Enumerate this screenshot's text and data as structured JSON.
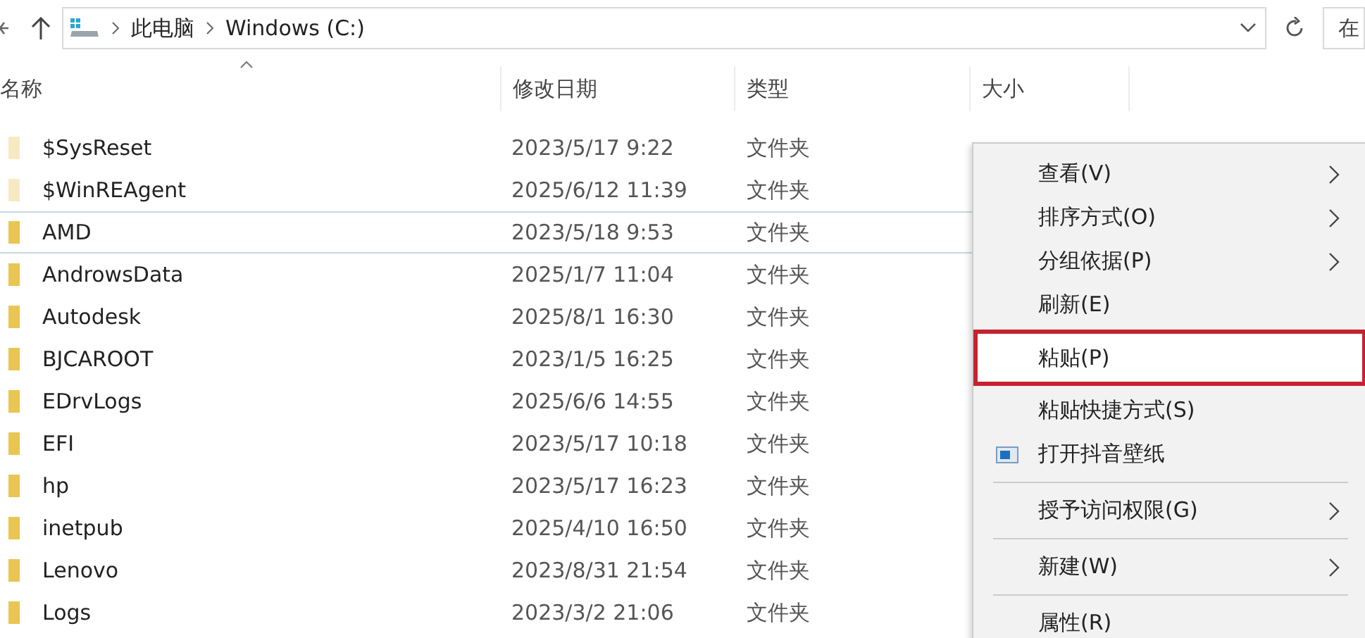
{
  "address_bar": {
    "path": [
      "此电脑",
      "Windows (C:)"
    ]
  },
  "search": {
    "placeholder": "在"
  },
  "table": {
    "columns": [
      {
        "label": "名称",
        "sorted": true
      },
      {
        "label": "修改日期",
        "sorted": false
      },
      {
        "label": "类型",
        "sorted": false
      },
      {
        "label": "大小",
        "sorted": false
      }
    ],
    "rows": [
      {
        "name": "$SysReset",
        "date": "2023/5/17 9:22",
        "type": "文件夹",
        "hidden": true,
        "focused": false
      },
      {
        "name": "$WinREAgent",
        "date": "2025/6/12 11:39",
        "type": "文件夹",
        "hidden": true,
        "focused": false
      },
      {
        "name": "AMD",
        "date": "2023/5/18 9:53",
        "type": "文件夹",
        "hidden": false,
        "focused": true
      },
      {
        "name": "AndrowsData",
        "date": "2025/1/7 11:04",
        "type": "文件夹",
        "hidden": false,
        "focused": false
      },
      {
        "name": "Autodesk",
        "date": "2025/8/1 16:30",
        "type": "文件夹",
        "hidden": false,
        "focused": false
      },
      {
        "name": "BJCAROOT",
        "date": "2023/1/5 16:25",
        "type": "文件夹",
        "hidden": false,
        "focused": false
      },
      {
        "name": "EDrvLogs",
        "date": "2025/6/6 14:55",
        "type": "文件夹",
        "hidden": false,
        "focused": false
      },
      {
        "name": "EFI",
        "date": "2023/5/17 10:18",
        "type": "文件夹",
        "hidden": false,
        "focused": false
      },
      {
        "name": "hp",
        "date": "2023/5/17 16:23",
        "type": "文件夹",
        "hidden": false,
        "focused": false
      },
      {
        "name": "inetpub",
        "date": "2025/4/10 16:50",
        "type": "文件夹",
        "hidden": false,
        "focused": false
      },
      {
        "name": "Lenovo",
        "date": "2023/8/31 21:54",
        "type": "文件夹",
        "hidden": false,
        "focused": false
      },
      {
        "name": "Logs",
        "date": "2023/3/2 21:06",
        "type": "文件夹",
        "hidden": false,
        "focused": false
      }
    ]
  },
  "context_menu": {
    "items": [
      {
        "kind": "item",
        "label": "查看(V)",
        "submenu": true,
        "icon": false,
        "highlighted": false
      },
      {
        "kind": "item",
        "label": "排序方式(O)",
        "submenu": true,
        "icon": false,
        "highlighted": false
      },
      {
        "kind": "item",
        "label": "分组依据(P)",
        "submenu": true,
        "icon": false,
        "highlighted": false
      },
      {
        "kind": "item",
        "label": "刷新(E)",
        "submenu": false,
        "icon": false,
        "highlighted": false
      },
      {
        "kind": "item",
        "label": "粘贴(P)",
        "submenu": false,
        "icon": false,
        "highlighted": true
      },
      {
        "kind": "item",
        "label": "粘贴快捷方式(S)",
        "submenu": false,
        "icon": false,
        "highlighted": false
      },
      {
        "kind": "item",
        "label": "打开抖音壁纸",
        "submenu": false,
        "icon": true,
        "highlighted": false
      },
      {
        "kind": "separator"
      },
      {
        "kind": "item",
        "label": "授予访问权限(G)",
        "submenu": true,
        "icon": false,
        "highlighted": false
      },
      {
        "kind": "separator"
      },
      {
        "kind": "item",
        "label": "新建(W)",
        "submenu": true,
        "icon": false,
        "highlighted": false
      },
      {
        "kind": "separator"
      },
      {
        "kind": "item",
        "label": "属性(R)",
        "submenu": false,
        "icon": false,
        "highlighted": false
      }
    ]
  }
}
